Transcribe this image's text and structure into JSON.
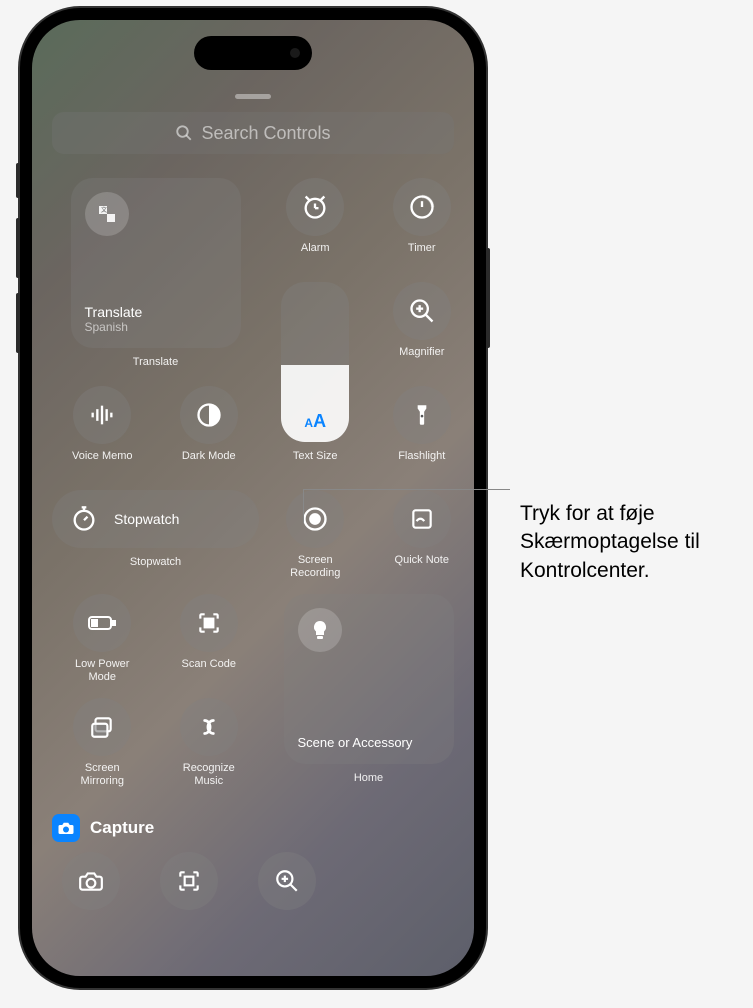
{
  "search": {
    "placeholder": "Search Controls"
  },
  "translate": {
    "title": "Translate",
    "subtitle": "Spanish",
    "label": "Translate"
  },
  "tiles": {
    "alarm": "Alarm",
    "timer": "Timer",
    "magnifier": "Magnifier",
    "voice_memo": "Voice Memo",
    "dark_mode": "Dark Mode",
    "text_size": "Text Size",
    "flashlight": "Flashlight",
    "stopwatch_inline": "Stopwatch",
    "stopwatch": "Stopwatch",
    "screen_recording": "Screen\nRecording",
    "quick_note": "Quick Note",
    "low_power": "Low Power\nMode",
    "scan_code": "Scan Code",
    "screen_mirroring": "Screen\nMirroring",
    "recognize_music": "Recognize\nMusic"
  },
  "home": {
    "title": "Scene or Accessory",
    "label": "Home"
  },
  "section": {
    "capture": "Capture"
  },
  "callout": "Tryk for at føje Skærmoptagelse til Kontrolcenter."
}
